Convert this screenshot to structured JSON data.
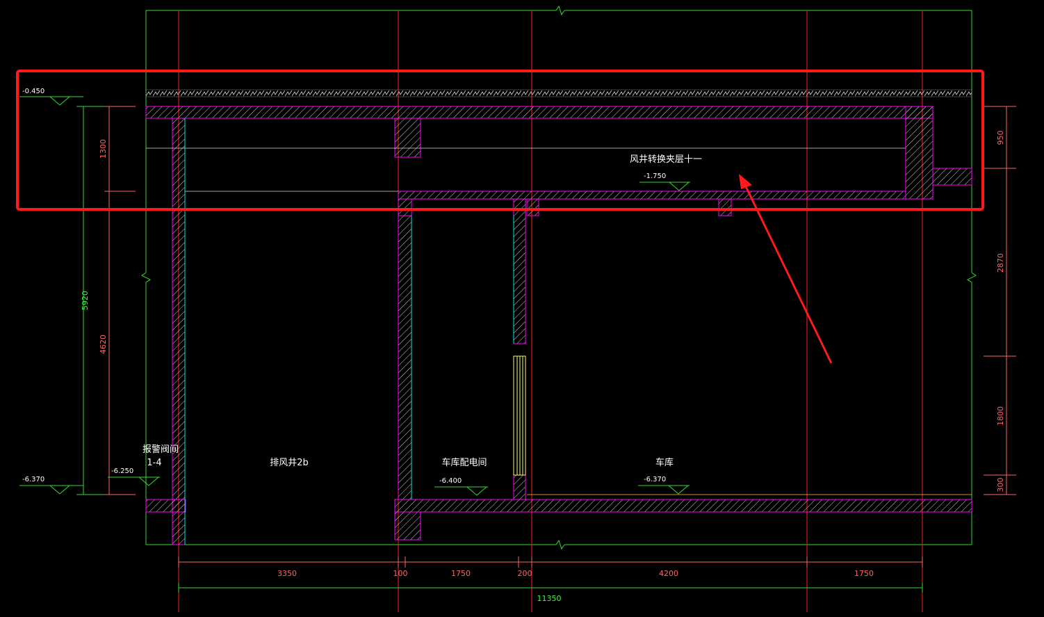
{
  "rooms": {
    "alarm_valve": "报警阀间",
    "alarm_valve_id": "1-4",
    "exhaust_shaft": "排风井2b",
    "garage_power": "车库配电间",
    "garage": "车库",
    "mezzanine": "风井转换夹层十一"
  },
  "elevations": {
    "top_left": "-0.450",
    "bottom_left": "-6.370",
    "alarm_floor": "-6.250",
    "power_room_floor": "-6.400",
    "garage_floor": "-6.370",
    "mezzanine_floor": "-1.750"
  },
  "vertical_dims_left": {
    "total": "5920",
    "upper": "1300",
    "lower": "4620"
  },
  "vertical_dims_right": {
    "d1": "950",
    "d2": "2870",
    "d3": "1800",
    "d4": "300"
  },
  "horizontal_dims": {
    "d1": "3350",
    "d2": "100",
    "d3": "1750",
    "d4": "200",
    "d5": "4200",
    "d6": "1750",
    "total": "11350"
  },
  "colors": {
    "background": "#000000",
    "axis_line": "#ff2020",
    "frame_line": "#33dd33",
    "wall_outline": "#ff00ff",
    "wall_hatch": "#d8d8d8",
    "finish_line": "#00e5e5",
    "annotation_red": "#ff1a1a"
  }
}
